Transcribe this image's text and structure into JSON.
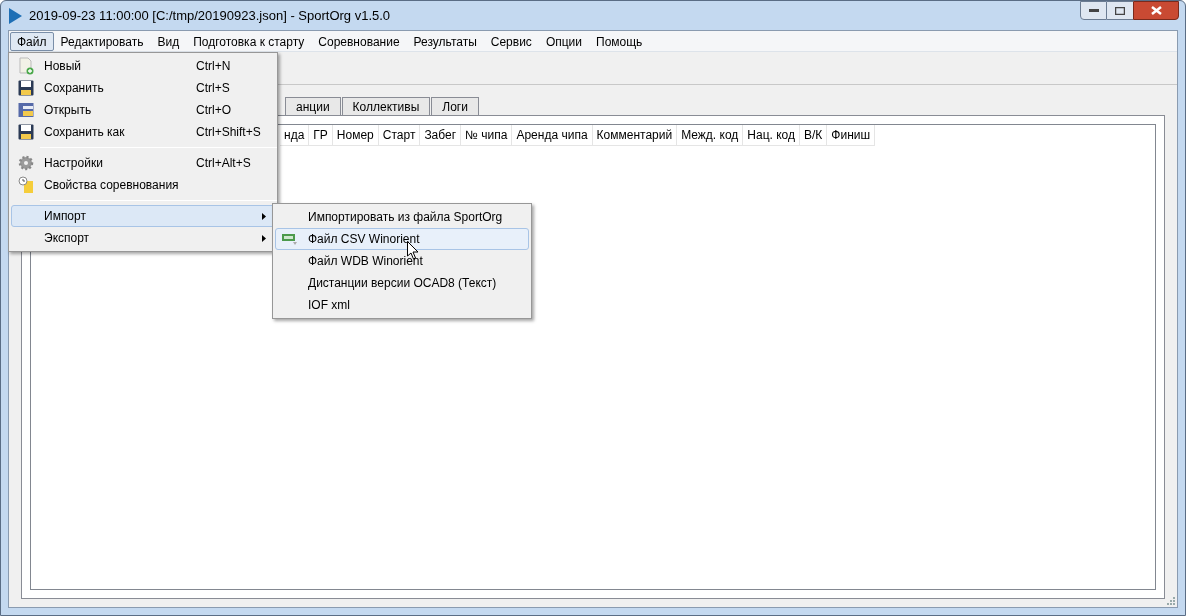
{
  "window": {
    "title": "2019-09-23 11:00:00 [C:/tmp/20190923.json] - SportOrg v1.5.0"
  },
  "menu_bar": [
    {
      "label": "Файл",
      "selected": true
    },
    {
      "label": "Редактировать",
      "selected": false
    },
    {
      "label": "Вид",
      "selected": false
    },
    {
      "label": "Подготовка к старту",
      "selected": false
    },
    {
      "label": "Соревнование",
      "selected": false
    },
    {
      "label": "Результаты",
      "selected": false
    },
    {
      "label": "Сервис",
      "selected": false
    },
    {
      "label": "Опции",
      "selected": false
    },
    {
      "label": "Помощь",
      "selected": false
    }
  ],
  "tabs": [
    {
      "label": "анции",
      "selected": false
    },
    {
      "label": "Коллективы",
      "selected": false
    },
    {
      "label": "Логи",
      "selected": false
    }
  ],
  "table": {
    "columns": [
      "нда",
      "ГР",
      "Номер",
      "Старт",
      "Забег",
      "№ чипа",
      "Аренда чипа",
      "Комментарий",
      "Межд. код",
      "Нац. код",
      "В/К",
      "Финиш"
    ]
  },
  "file_menu": {
    "items": [
      {
        "kind": "item",
        "label": "Новый",
        "shortcut": "Ctrl+N",
        "selected": false
      },
      {
        "kind": "item",
        "label": "Сохранить",
        "shortcut": "Ctrl+S",
        "selected": false
      },
      {
        "kind": "item",
        "label": "Открыть",
        "shortcut": "Ctrl+O",
        "selected": false
      },
      {
        "kind": "item",
        "label": "Сохранить как",
        "shortcut": "Ctrl+Shift+S",
        "selected": false
      },
      {
        "kind": "separator"
      },
      {
        "kind": "item",
        "label": "Настройки",
        "shortcut": "Ctrl+Alt+S",
        "selected": false
      },
      {
        "kind": "item",
        "label": "Свойства соревнования",
        "selected": false
      },
      {
        "kind": "separator"
      },
      {
        "kind": "submenu",
        "label": "Импорт",
        "selected": true
      },
      {
        "kind": "submenu",
        "label": "Экспорт",
        "selected": false
      }
    ]
  },
  "import_menu": {
    "items": [
      {
        "label": "Импортировать из файла SportOrg",
        "selected": false
      },
      {
        "label": "Файл CSV Winorient",
        "selected": true
      },
      {
        "label": "Файл WDB Winorient",
        "selected": false
      },
      {
        "label": "Дистанции версии OCAD8 (Текст)",
        "selected": false
      },
      {
        "label": "IOF xml",
        "selected": false
      }
    ]
  }
}
